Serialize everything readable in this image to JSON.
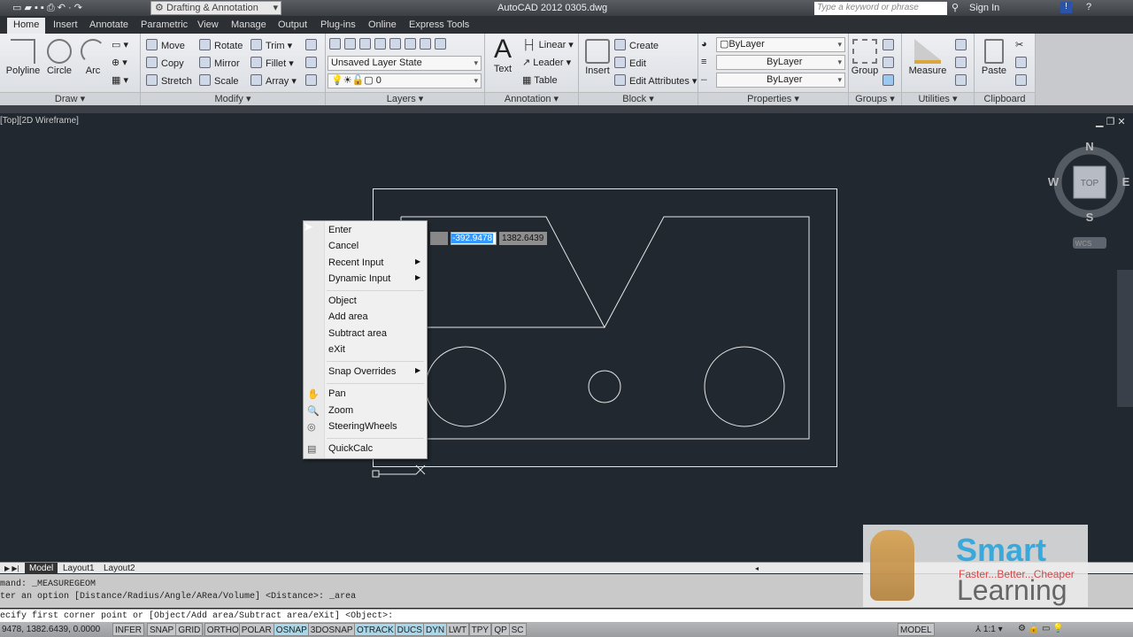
{
  "title_bar": {
    "workspace": "Drafting & Annotation",
    "app_title": "AutoCAD 2012    0305.dwg",
    "search_placeholder": "Type a keyword or phrase",
    "sign_in": "Sign In"
  },
  "tabs": [
    "Home",
    "Insert",
    "Annotate",
    "Parametric",
    "View",
    "Manage",
    "Output",
    "Plug-ins",
    "Online",
    "Express Tools"
  ],
  "ribbon": {
    "draw": {
      "label": "Draw ▾",
      "polyline": "Polyline",
      "circle": "Circle",
      "arc": "Arc"
    },
    "modify": {
      "label": "Modify ▾",
      "items": [
        "Move",
        "Rotate",
        "Trim",
        "Copy",
        "Mirror",
        "Fillet",
        "Stretch",
        "Scale",
        "Array"
      ]
    },
    "layers": {
      "label": "Layers ▾",
      "layer_state": "Unsaved Layer State",
      "current_layer": "0"
    },
    "annotation": {
      "label": "Annotation ▾",
      "text": "Text",
      "linear": "Linear",
      "leader": "Leader",
      "table": "Table"
    },
    "block": {
      "label": "Block ▾",
      "insert": "Insert",
      "create": "Create",
      "edit": "Edit",
      "edit_attributes": "Edit Attributes"
    },
    "properties": {
      "label": "Properties ▾",
      "color": "ByLayer",
      "linetype": "ByLayer",
      "lineweight": "ByLayer"
    },
    "groups": {
      "label": "Groups ▾",
      "group": "Group"
    },
    "utilities": {
      "label": "Utilities ▾",
      "measure": "Measure"
    },
    "clipboard": {
      "label": "Clipboard",
      "paste": "Paste"
    }
  },
  "viewport": {
    "label": "[Top][2D Wireframe]",
    "viewcube": {
      "n": "N",
      "s": "S",
      "e": "E",
      "w": "W",
      "top": "TOP",
      "wcs": "WCS"
    }
  },
  "dynamic_input": {
    "x": "-392.9478",
    "y": "1382.6439"
  },
  "context_menu": [
    {
      "label": "Enter"
    },
    {
      "label": "Cancel"
    },
    {
      "label": "Recent Input",
      "submenu": true
    },
    {
      "label": "Dynamic Input",
      "submenu": true
    },
    {
      "label": "Object"
    },
    {
      "label": "Add area"
    },
    {
      "label": "Subtract area"
    },
    {
      "label": "eXit"
    },
    {
      "label": "Snap Overrides",
      "submenu": true
    },
    {
      "label": "Pan"
    },
    {
      "label": "Zoom"
    },
    {
      "label": "SteeringWheels"
    },
    {
      "label": "QuickCalc"
    }
  ],
  "layout_tabs": [
    "Model",
    "Layout1",
    "Layout2"
  ],
  "command_history": [
    "mand:  _MEASUREGEOM",
    "ter an option [Distance/Radius/Angle/ARea/Volume] <Distance>: _area"
  ],
  "command_line": "ecify first corner point or [Object/Add area/Subtract area/eXit] <Object>:",
  "status": {
    "coords": "9478, 1382.6439, 0.0000",
    "toggles": [
      {
        "label": "INFER",
        "on": false
      },
      {
        "label": "SNAP",
        "on": false
      },
      {
        "label": "GRID",
        "on": false
      },
      {
        "label": "ORTHO",
        "on": false
      },
      {
        "label": "POLAR",
        "on": false
      },
      {
        "label": "OSNAP",
        "on": true
      },
      {
        "label": "3DOSNAP",
        "on": false
      },
      {
        "label": "OTRACK",
        "on": true
      },
      {
        "label": "DUCS",
        "on": true
      },
      {
        "label": "DYN",
        "on": true
      },
      {
        "label": "LWT",
        "on": false
      },
      {
        "label": "TPY",
        "on": false
      },
      {
        "label": "QP",
        "on": false
      },
      {
        "label": "SC",
        "on": false
      }
    ],
    "model": "MODEL",
    "scale": "1:1"
  },
  "watermark": {
    "brand": "Smart",
    "tagline": "Faster...Better...Cheaper",
    "word": "Learning"
  }
}
